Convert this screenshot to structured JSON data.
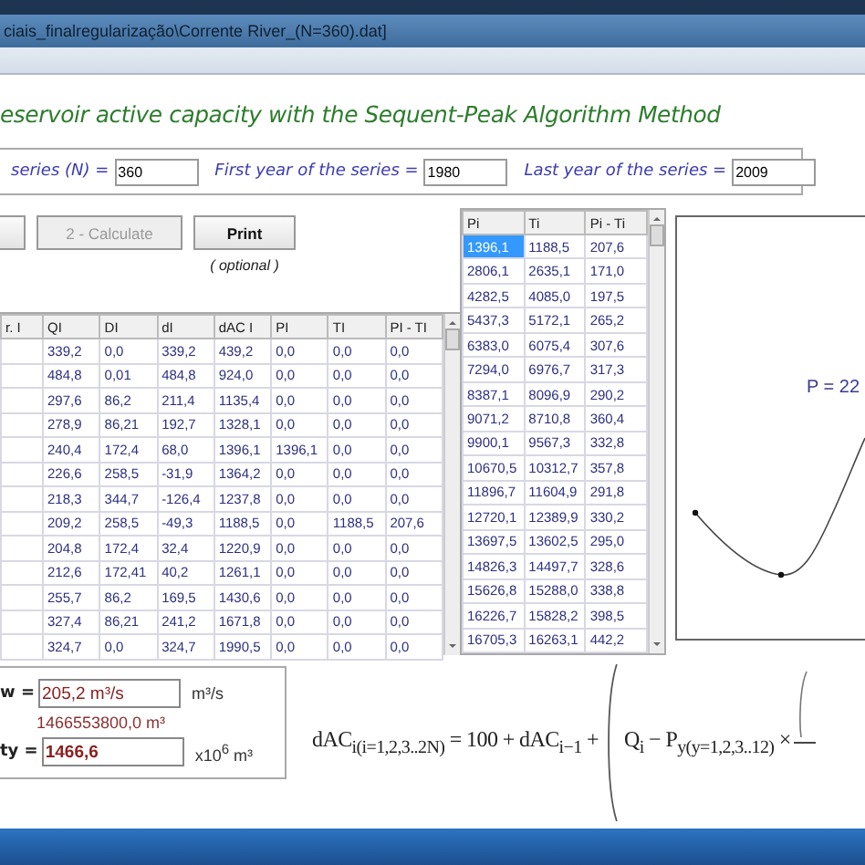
{
  "window": {
    "title": "ciais_finalregularização\\Corrente River_(N=360).dat]"
  },
  "heading": "eservoir active capacity with the Sequent-Peak Algorithm Method",
  "series_inputs": [
    {
      "label": "series (N) =",
      "value": "360"
    },
    {
      "label": "First year of the series =",
      "value": "1980"
    },
    {
      "label": "Last year of the series =",
      "value": "2009"
    }
  ],
  "buttons": [
    {
      "label": "2 - Calculate",
      "disabled": true
    },
    {
      "label": "Print",
      "disabled": false
    }
  ],
  "print_note": "( optional )",
  "main_table": {
    "columns": [
      "r. I",
      "QI",
      "DI",
      "dI",
      "dAC I",
      "PI",
      "TI",
      "PI - TI"
    ],
    "rows": [
      [
        "",
        "339,2",
        "0,0",
        "339,2",
        "439,2",
        "0,0",
        "0,0",
        "0,0"
      ],
      [
        "",
        "484,8",
        "0,01",
        "484,8",
        "924,0",
        "0,0",
        "0,0",
        "0,0"
      ],
      [
        "",
        "297,6",
        "86,2",
        "211,4",
        "1135,4",
        "0,0",
        "0,0",
        "0,0"
      ],
      [
        "",
        "278,9",
        "86,21",
        "192,7",
        "1328,1",
        "0,0",
        "0,0",
        "0,0"
      ],
      [
        "",
        "240,4",
        "172,4",
        "68,0",
        "1396,1",
        "1396,1",
        "0,0",
        "0,0"
      ],
      [
        "",
        "226,6",
        "258,5",
        "-31,9",
        "1364,2",
        "0,0",
        "0,0",
        "0,0"
      ],
      [
        "",
        "218,3",
        "344,7",
        "-126,4",
        "1237,8",
        "0,0",
        "0,0",
        "0,0"
      ],
      [
        "",
        "209,2",
        "258,5",
        "-49,3",
        "1188,5",
        "0,0",
        "1188,5",
        "207,6"
      ],
      [
        "",
        "204,8",
        "172,4",
        "32,4",
        "1220,9",
        "0,0",
        "0,0",
        "0,0"
      ],
      [
        "",
        "212,6",
        "172,41",
        "40,2",
        "1261,1",
        "0,0",
        "0,0",
        "0,0"
      ],
      [
        "",
        "255,7",
        "86,2",
        "169,5",
        "1430,6",
        "0,0",
        "0,0",
        "0,0"
      ],
      [
        "",
        "327,4",
        "86,21",
        "241,2",
        "1671,8",
        "0,0",
        "0,0",
        "0,0"
      ],
      [
        "",
        "324,7",
        "0,0",
        "324,7",
        "1990,5",
        "0,0",
        "0,0",
        "0,0"
      ]
    ]
  },
  "peaks_table": {
    "columns": [
      "Pi",
      "Ti",
      "Pi - Ti"
    ],
    "rows": [
      {
        "cells": [
          "1396,1",
          "1188,5",
          "207,6"
        ],
        "selected": true
      },
      {
        "cells": [
          "2806,1",
          "2635,1",
          "171,0"
        ],
        "selected": false
      },
      {
        "cells": [
          "4282,5",
          "4085,0",
          "197,5"
        ],
        "selected": false
      },
      {
        "cells": [
          "5437,3",
          "5172,1",
          "265,2"
        ],
        "selected": false
      },
      {
        "cells": [
          "6383,0",
          "6075,4",
          "307,6"
        ],
        "selected": false
      },
      {
        "cells": [
          "7294,0",
          "6976,7",
          "317,3"
        ],
        "selected": false
      },
      {
        "cells": [
          "8387,1",
          "8096,9",
          "290,2"
        ],
        "selected": false
      },
      {
        "cells": [
          "9071,2",
          "8710,8",
          "360,4"
        ],
        "selected": false
      },
      {
        "cells": [
          "9900,1",
          "9567,3",
          "332,8"
        ],
        "selected": false
      },
      {
        "cells": [
          "10670,5",
          "10312,7",
          "357,8"
        ],
        "selected": false
      },
      {
        "cells": [
          "11896,7",
          "11604,9",
          "291,8"
        ],
        "selected": false
      },
      {
        "cells": [
          "12720,1",
          "12389,9",
          "330,2"
        ],
        "selected": false
      },
      {
        "cells": [
          "13697,5",
          "13602,5",
          "295,0"
        ],
        "selected": false
      },
      {
        "cells": [
          "14826,3",
          "14497,7",
          "328,6"
        ],
        "selected": false
      },
      {
        "cells": [
          "15626,8",
          "15288,0",
          "338,8"
        ],
        "selected": false
      },
      {
        "cells": [
          "16226,7",
          "15828,2",
          "398,5"
        ],
        "selected": false
      },
      {
        "cells": [
          "16705,3",
          "16263,1",
          "442,2"
        ],
        "selected": false
      }
    ]
  },
  "chart": {
    "label": "P = 22"
  },
  "results": {
    "flow_label": "w =",
    "flow_value": "205,2 m³/s",
    "flow_unit": "m³/s",
    "volume": "1466553800,0 m³",
    "capacity_label": "ty =",
    "capacity_value": "1466,6",
    "capacity_unit": "x10$^{6}$ m³"
  },
  "formula": {
    "left": "dAC$_{i(i=1,2,3..2N)}$ = 100 + dAC$_{i−1}$ +",
    "right": "Q$_{i}$ − P$_{y(y=1,2,3..12)}$ ×"
  }
}
